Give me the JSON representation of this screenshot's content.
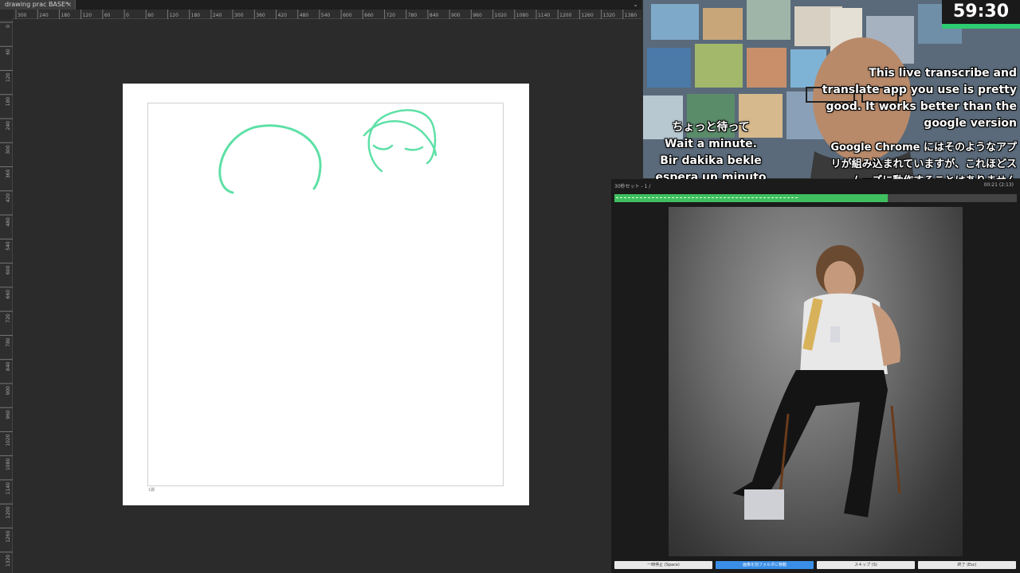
{
  "app": {
    "tab_title": "drawing prac BASE*",
    "tab_close": "×",
    "menu_arrow": "⌄",
    "ruler_top": [
      "300",
      "240",
      "180",
      "120",
      "60",
      "0",
      "60",
      "120",
      "180",
      "240",
      "300",
      "360",
      "420",
      "480",
      "540",
      "600",
      "660",
      "720",
      "780",
      "840",
      "900",
      "960",
      "1020",
      "1080",
      "1140",
      "1200",
      "1260",
      "1320",
      "1380"
    ],
    "ruler_left": [
      "0",
      "60",
      "120",
      "180",
      "240",
      "300",
      "360",
      "420",
      "480",
      "540",
      "600",
      "660",
      "720",
      "780",
      "840",
      "900",
      "960",
      "1020",
      "1080",
      "1140",
      "1200",
      "1260",
      "1320"
    ],
    "canvas_tag": "1脚",
    "stroke_color": "#5ee0a6"
  },
  "overlay": {
    "timer": "59:30",
    "captions_left": [
      "ちょっと待って",
      "Wait a minute.",
      "Bir dakika bekle",
      "espera un minuto"
    ],
    "captions_right_en": "This live transcribe and translate app you use is pretty good. It works better than the google version",
    "captions_right_jp": "Google Chrome にはそのようなアプリが組み込まれていますが、これほどスムーズに動作することはありません"
  },
  "reference": {
    "header": "30秒セット - 1 /",
    "time": "00:21 (2:13)",
    "progress": 0.68,
    "buttons": [
      "一時停止 (Space)",
      "画像を別フォルダに移動",
      "スキップ (S)",
      "終了 (Esc)"
    ]
  },
  "colors": {
    "accent": "#3fbf5f",
    "primary_button": "#3a8ee6"
  }
}
